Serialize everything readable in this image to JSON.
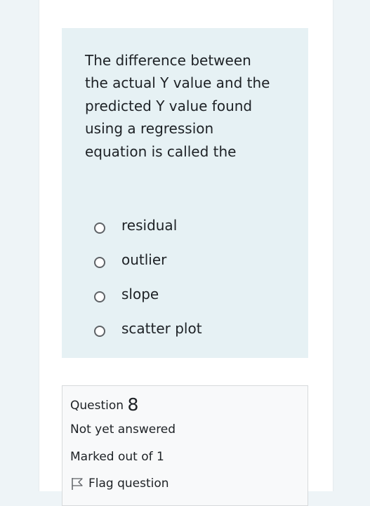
{
  "question": {
    "text_lines": [
      "The difference between",
      "the actual Y value and the",
      "predicted Y value found",
      "using a regression",
      "equation is called the"
    ],
    "answers": [
      {
        "label": "residual"
      },
      {
        "label": "outlier"
      },
      {
        "label": "slope"
      },
      {
        "label": "scatter plot"
      }
    ]
  },
  "info": {
    "question_label": "Question",
    "question_number": "8",
    "status": "Not yet answered",
    "grade": "Marked out of 1",
    "flag_label": "Flag question"
  },
  "colors": {
    "background": "#eef4f7",
    "question_card": "#e6f1f4",
    "info_card": "#f8f9fa",
    "text": "#1d2125"
  },
  "icons": {
    "flag": "flag-icon",
    "radio": "radio-unchecked-icon"
  }
}
